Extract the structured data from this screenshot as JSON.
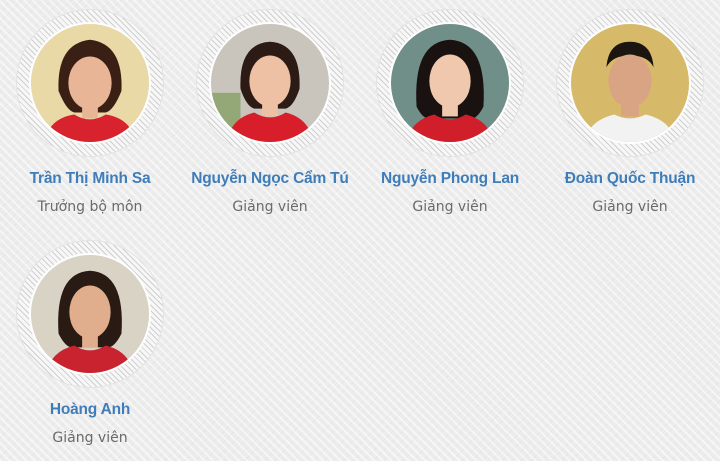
{
  "team": {
    "members": [
      {
        "name": "Trần Thị Minh Sa",
        "role": "Trưởng bộ môn",
        "photo_alt": "Trần Thị Minh Sa",
        "bg_color": "#e9d9a6",
        "shirt_color": "#d8222d",
        "hair_color": "#3a1f14",
        "skin_color": "#e8b596"
      },
      {
        "name": "Nguyễn Ngọc Cẩm Tú",
        "role": "Giảng viên",
        "photo_alt": "Nguyễn Ngọc Cẩm Tú",
        "bg_color": "#c9c5bd",
        "shirt_color": "#d81e2a",
        "hair_color": "#2b1b14",
        "skin_color": "#eec1a4"
      },
      {
        "name": "Nguyễn Phong Lan",
        "role": "Giảng viên",
        "photo_alt": "Nguyễn Phong Lan",
        "bg_color": "#6f8f88",
        "shirt_color": "#d01e2a",
        "hair_color": "#1a1210",
        "skin_color": "#f0c8ad"
      },
      {
        "name": "Đoàn Quốc Thuận",
        "role": "Giảng viên",
        "photo_alt": "Đoàn Quốc Thuận",
        "bg_color": "#d7b96a",
        "shirt_color": "#f2f2f2",
        "hair_color": "#1b1410",
        "skin_color": "#d8a483"
      },
      {
        "name": "Hoàng Anh",
        "role": "Giảng viên",
        "photo_alt": "Hoàng Anh",
        "bg_color": "#d9d3c6",
        "shirt_color": "#c8232e",
        "hair_color": "#2a1a14",
        "skin_color": "#e0ad8d"
      }
    ]
  },
  "colors": {
    "name_link": "#3f7dba",
    "role_text": "#6a6a6a",
    "page_background": "#ececec"
  }
}
